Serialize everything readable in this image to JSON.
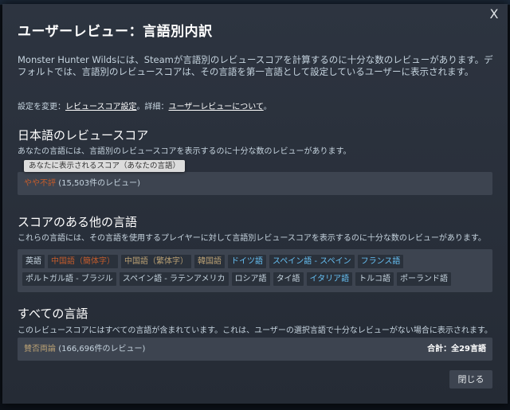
{
  "dialog": {
    "title": "ユーザーレビュー：言語別内訳",
    "close_glyph": "X",
    "intro": "Monster Hunter Wildsには、Steamが言語別のレビュースコアを計算するのに十分な数のレビューがあります。デフォルトでは、言語別のレビュースコアは、その言語を第一言語として設定しているユーザーに表示されます。",
    "settings": {
      "prefix": "設定を変更：",
      "link1": "レビュースコア設定",
      "middle": "。詳細：",
      "link2": "ユーザーレビューについて",
      "suffix": "。"
    },
    "close_button": "閉じる"
  },
  "your_language": {
    "heading": "日本語のレビュースコア",
    "desc": "あなたの言語には、言語別のレビュースコアを表示するのに十分な数のレビューがあります。",
    "tooltip": "あなたに表示されるスコア（あなたの言語）",
    "score_label": "やや不評",
    "score_count": "(15,503件のレビュー)"
  },
  "other_languages": {
    "heading": "スコアのある他の言語",
    "desc": "これらの言語には、その言語を使用するプレイヤーに対して言語別レビュースコアを表示するのに十分な数のレビューがあります。",
    "row1": [
      {
        "label": "英語",
        "rating": "none"
      },
      {
        "label": "中国語（簡体字）",
        "rating": "neg"
      },
      {
        "label": "中国語（繁体字）",
        "rating": "mix"
      },
      {
        "label": "韓国語",
        "rating": "mix"
      },
      {
        "label": "ドイツ語",
        "rating": "pos"
      },
      {
        "label": "スペイン語 - スペイン",
        "rating": "pos"
      },
      {
        "label": "フランス語",
        "rating": "pos"
      }
    ],
    "row2": [
      {
        "label": "ポルトガル語 - ブラジル",
        "rating": "none"
      },
      {
        "label": "スペイン語 - ラテンアメリカ",
        "rating": "none"
      },
      {
        "label": "ロシア語",
        "rating": "none"
      },
      {
        "label": "タイ語",
        "rating": "none"
      },
      {
        "label": "イタリア語",
        "rating": "pos"
      },
      {
        "label": "トルコ語",
        "rating": "none"
      },
      {
        "label": "ポーランド語",
        "rating": "none"
      }
    ]
  },
  "all_languages": {
    "heading": "すべての言語",
    "desc": "このレビュースコアにはすべての言語が含まれています。これは、ユーザーの選択言語で十分なレビューがない場合に表示されます。",
    "score_label": "賛否両論",
    "score_count": "(166,696件のレビュー)",
    "total": "合計：全29言語"
  },
  "colors": {
    "mostly_negative": "#c35c2c",
    "mixed": "#b9a074",
    "positive": "#66c0f4"
  }
}
